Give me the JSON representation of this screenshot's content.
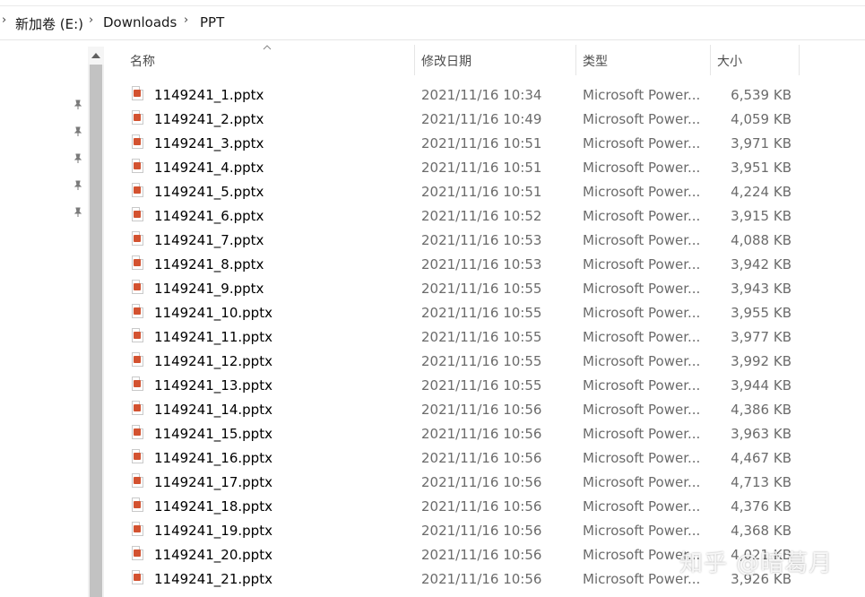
{
  "breadcrumb": {
    "items": [
      "新加卷 (E:)",
      "Downloads",
      "PPT"
    ],
    "separator": "›"
  },
  "columns": {
    "name": "名称",
    "date": "修改日期",
    "type": "类型",
    "size": "大小"
  },
  "files": [
    {
      "name": "1149241_1.pptx",
      "date": "2021/11/16 10:34",
      "type": "Microsoft Power...",
      "size": "6,539 KB"
    },
    {
      "name": "1149241_2.pptx",
      "date": "2021/11/16 10:49",
      "type": "Microsoft Power...",
      "size": "4,059 KB"
    },
    {
      "name": "1149241_3.pptx",
      "date": "2021/11/16 10:51",
      "type": "Microsoft Power...",
      "size": "3,971 KB"
    },
    {
      "name": "1149241_4.pptx",
      "date": "2021/11/16 10:51",
      "type": "Microsoft Power...",
      "size": "3,951 KB"
    },
    {
      "name": "1149241_5.pptx",
      "date": "2021/11/16 10:51",
      "type": "Microsoft Power...",
      "size": "4,224 KB"
    },
    {
      "name": "1149241_6.pptx",
      "date": "2021/11/16 10:52",
      "type": "Microsoft Power...",
      "size": "3,915 KB"
    },
    {
      "name": "1149241_7.pptx",
      "date": "2021/11/16 10:53",
      "type": "Microsoft Power...",
      "size": "4,088 KB"
    },
    {
      "name": "1149241_8.pptx",
      "date": "2021/11/16 10:53",
      "type": "Microsoft Power...",
      "size": "3,942 KB"
    },
    {
      "name": "1149241_9.pptx",
      "date": "2021/11/16 10:55",
      "type": "Microsoft Power...",
      "size": "3,943 KB"
    },
    {
      "name": "1149241_10.pptx",
      "date": "2021/11/16 10:55",
      "type": "Microsoft Power...",
      "size": "3,955 KB"
    },
    {
      "name": "1149241_11.pptx",
      "date": "2021/11/16 10:55",
      "type": "Microsoft Power...",
      "size": "3,977 KB"
    },
    {
      "name": "1149241_12.pptx",
      "date": "2021/11/16 10:55",
      "type": "Microsoft Power...",
      "size": "3,992 KB"
    },
    {
      "name": "1149241_13.pptx",
      "date": "2021/11/16 10:55",
      "type": "Microsoft Power...",
      "size": "3,944 KB"
    },
    {
      "name": "1149241_14.pptx",
      "date": "2021/11/16 10:56",
      "type": "Microsoft Power...",
      "size": "4,386 KB"
    },
    {
      "name": "1149241_15.pptx",
      "date": "2021/11/16 10:56",
      "type": "Microsoft Power...",
      "size": "3,963 KB"
    },
    {
      "name": "1149241_16.pptx",
      "date": "2021/11/16 10:56",
      "type": "Microsoft Power...",
      "size": "4,467 KB"
    },
    {
      "name": "1149241_17.pptx",
      "date": "2021/11/16 10:56",
      "type": "Microsoft Power...",
      "size": "4,713 KB"
    },
    {
      "name": "1149241_18.pptx",
      "date": "2021/11/16 10:56",
      "type": "Microsoft Power...",
      "size": "4,376 KB"
    },
    {
      "name": "1149241_19.pptx",
      "date": "2021/11/16 10:56",
      "type": "Microsoft Power...",
      "size": "4,368 KB"
    },
    {
      "name": "1149241_20.pptx",
      "date": "2021/11/16 10:56",
      "type": "Microsoft Power...",
      "size": "4,021 KB"
    },
    {
      "name": "1149241_21.pptx",
      "date": "2021/11/16 10:56",
      "type": "Microsoft Power...",
      "size": "3,926 KB"
    }
  ],
  "nav": {
    "pin_icon": "pin-icon",
    "pin_glyph": "📌"
  },
  "watermark": "知乎 @暗葛月",
  "colors": {
    "pptx_icon": "#d35230",
    "scrollbar_thumb": "#c2c2c2"
  }
}
